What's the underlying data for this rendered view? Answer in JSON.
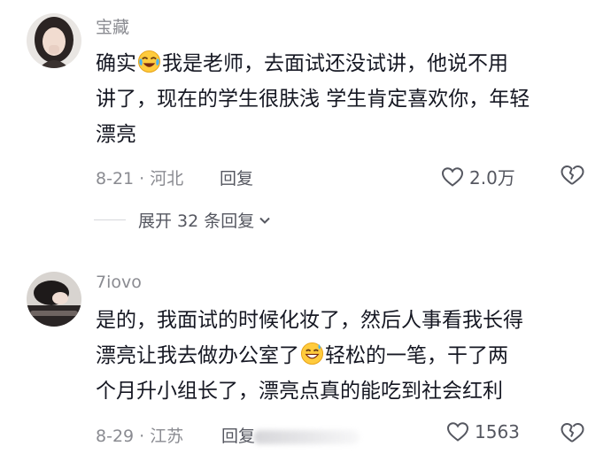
{
  "comments": [
    {
      "username": "宝藏",
      "text_before_emoji": "确实",
      "emoji": "crying-laughing-emoji",
      "text_line1_after": "我是老师，去面试还没试讲，他说不用",
      "text_line2": "讲了，现在的学生很肤浅 学生肯定喜欢你，年轻",
      "text_line3": "漂亮",
      "date_location": "8-21 · 河北",
      "reply_label": "回复",
      "like_count": "2.0万",
      "expand_label": "展开 32 条回复"
    },
    {
      "username": "7iovo",
      "text_line1": "是的，我面试的时候化妆了，然后人事看我长得",
      "text_line2_before": "漂亮让我去做办公室了",
      "emoji": "grinning-sweat-emoji",
      "text_line2_after": "轻松的一笔，干了两",
      "text_line3": "个月升小组长了，漂亮点真的能吃到社会红利",
      "date_location": "8-29 · 江苏",
      "reply_label": "回复",
      "like_count": "1563"
    }
  ],
  "colors": {
    "text": "#161823",
    "secondary": "#8a8b91",
    "action": "#555760"
  }
}
